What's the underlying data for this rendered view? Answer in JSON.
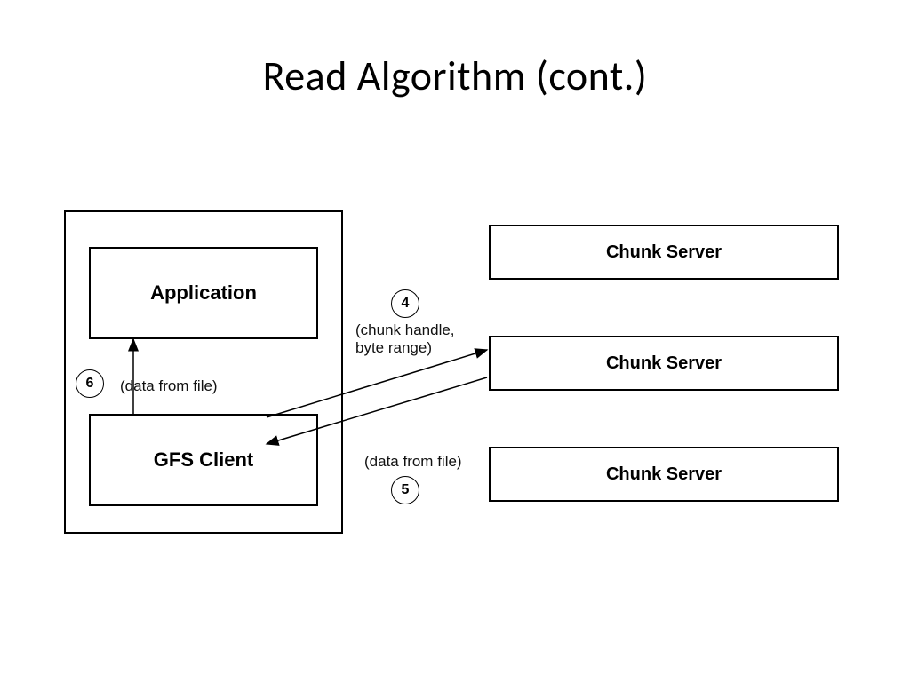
{
  "title": "Read Algorithm (cont.)",
  "left": {
    "application": "Application",
    "gfs_client": "GFS Client"
  },
  "right": {
    "server1": "Chunk Server",
    "server2": "Chunk Server",
    "server3": "Chunk Server"
  },
  "steps": {
    "s4": "4",
    "s5": "5",
    "s6": "6"
  },
  "labels": {
    "chunk_handle_byte_range": "(chunk handle,\nbyte range)",
    "data_from_file_a": "(data from file)",
    "data_from_file_b": "(data from file)"
  }
}
